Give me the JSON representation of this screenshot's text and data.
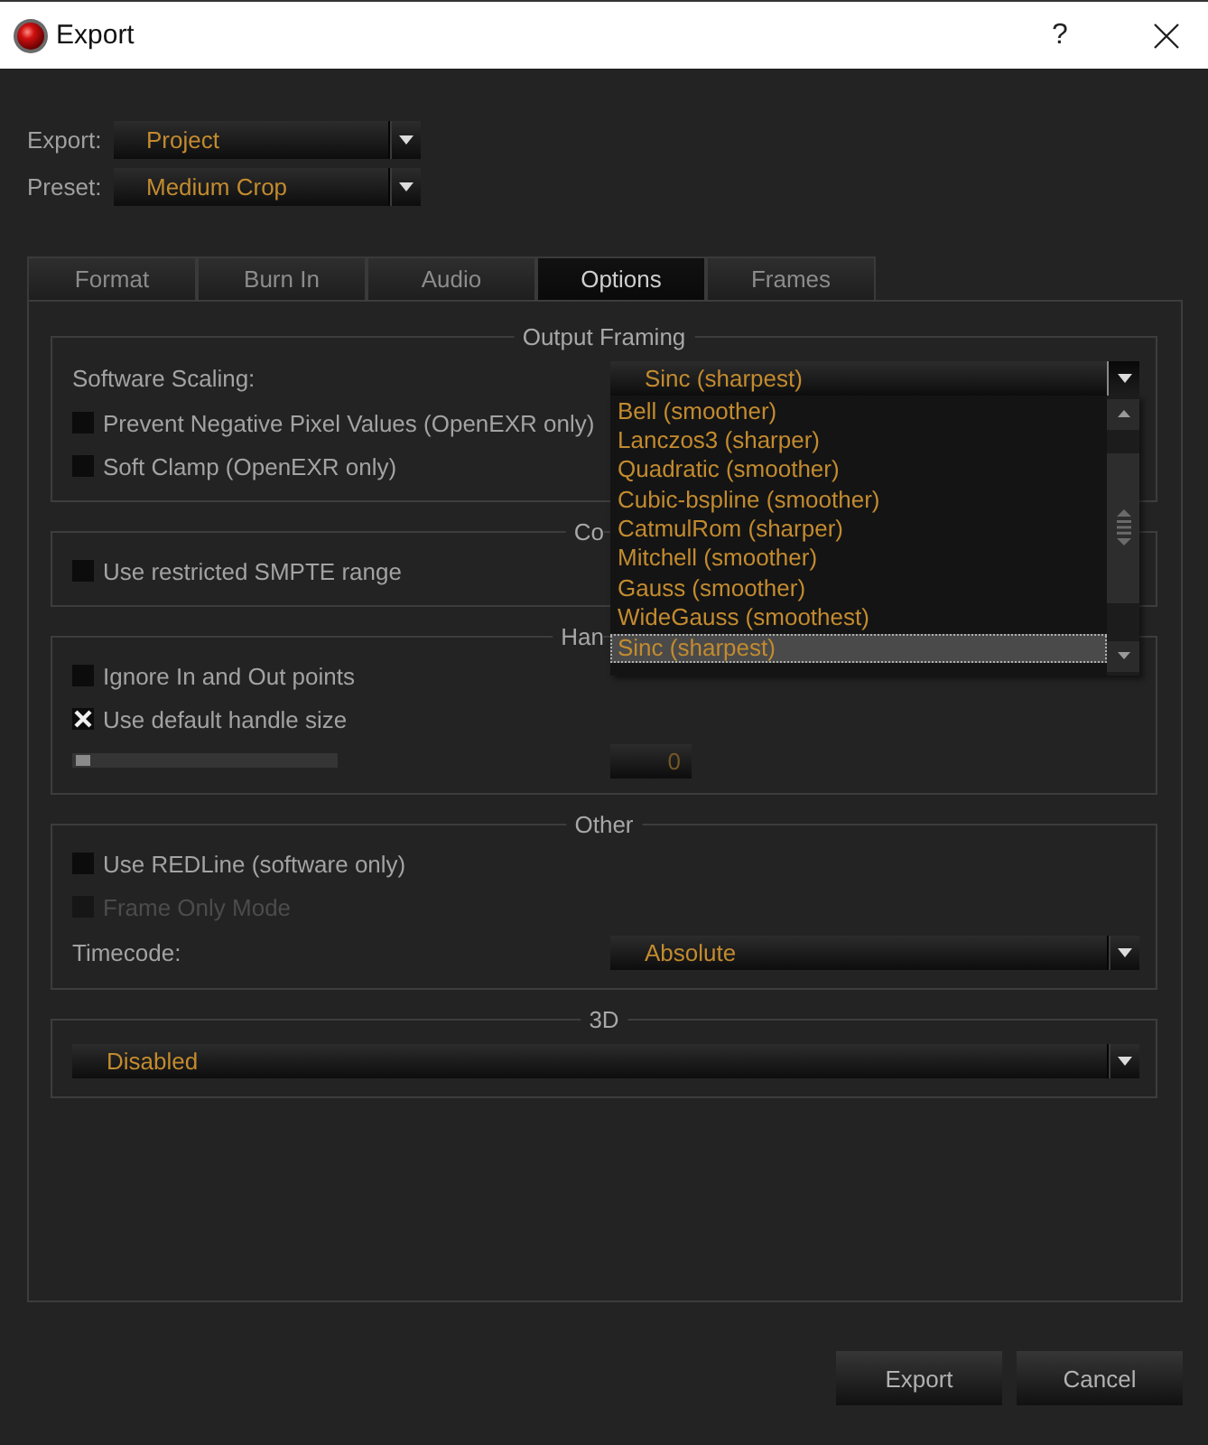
{
  "window": {
    "title": "Export",
    "help_label": "?"
  },
  "fields": [
    {
      "label": "Export:",
      "value": "Project"
    },
    {
      "label": "Preset:",
      "value": "Medium Crop"
    }
  ],
  "tabs": [
    {
      "label": "Format",
      "selected": false
    },
    {
      "label": "Burn In",
      "selected": false
    },
    {
      "label": "Audio",
      "selected": false
    },
    {
      "label": "Options",
      "selected": true
    },
    {
      "label": "Frames",
      "selected": false
    }
  ],
  "groups": [
    {
      "title": "Output Framing",
      "rows": [
        {
          "kind": "combo",
          "label": "Software Scaling:",
          "value": "Sinc (sharpest)",
          "expanded": true,
          "options": [
            {
              "label": "Bell (smoother)",
              "selected": false
            },
            {
              "label": "Lanczos3 (sharper)",
              "selected": false
            },
            {
              "label": "Quadratic (smoother)",
              "selected": false
            },
            {
              "label": "Cubic-bspline (smoother)",
              "selected": false
            },
            {
              "label": "CatmulRom (sharper)",
              "selected": false
            },
            {
              "label": "Mitchell (smoother)",
              "selected": false
            },
            {
              "label": "Gauss (smoother)",
              "selected": false
            },
            {
              "label": "WideGauss (smoothest)",
              "selected": false
            },
            {
              "label": "Sinc (sharpest)",
              "selected": true
            }
          ]
        },
        {
          "kind": "checkbox",
          "label": "Prevent Negative Pixel Values (OpenEXR only)",
          "checked": false,
          "disabled": false
        },
        {
          "kind": "checkbox",
          "label": "Soft Clamp (OpenEXR only)",
          "checked": false,
          "disabled": false
        }
      ]
    },
    {
      "title": "Co",
      "rows": [
        {
          "kind": "checkbox",
          "label": "Use restricted SMPTE range",
          "checked": false,
          "disabled": false
        }
      ]
    },
    {
      "title": "Han",
      "rows": [
        {
          "kind": "checkbox",
          "label": "Ignore In and Out points",
          "checked": false,
          "disabled": false
        },
        {
          "kind": "checkbox",
          "label": "Use default handle size",
          "checked": true,
          "disabled": false
        },
        {
          "kind": "slider",
          "level": 0,
          "value": "0"
        }
      ]
    },
    {
      "title": "Other",
      "rows": [
        {
          "kind": "checkbox",
          "label": "Use REDLine (software only)",
          "checked": false,
          "disabled": false
        },
        {
          "kind": "checkbox",
          "label": "Frame Only Mode",
          "checked": false,
          "disabled": true
        },
        {
          "kind": "combo",
          "label": "Timecode:",
          "value": "Absolute",
          "expanded": false
        }
      ]
    },
    {
      "title": "3D",
      "rows": [
        {
          "kind": "combo",
          "value": "Disabled",
          "expanded": false
        }
      ]
    }
  ],
  "buttons": [
    {
      "label": "Export"
    },
    {
      "label": "Cancel"
    }
  ]
}
